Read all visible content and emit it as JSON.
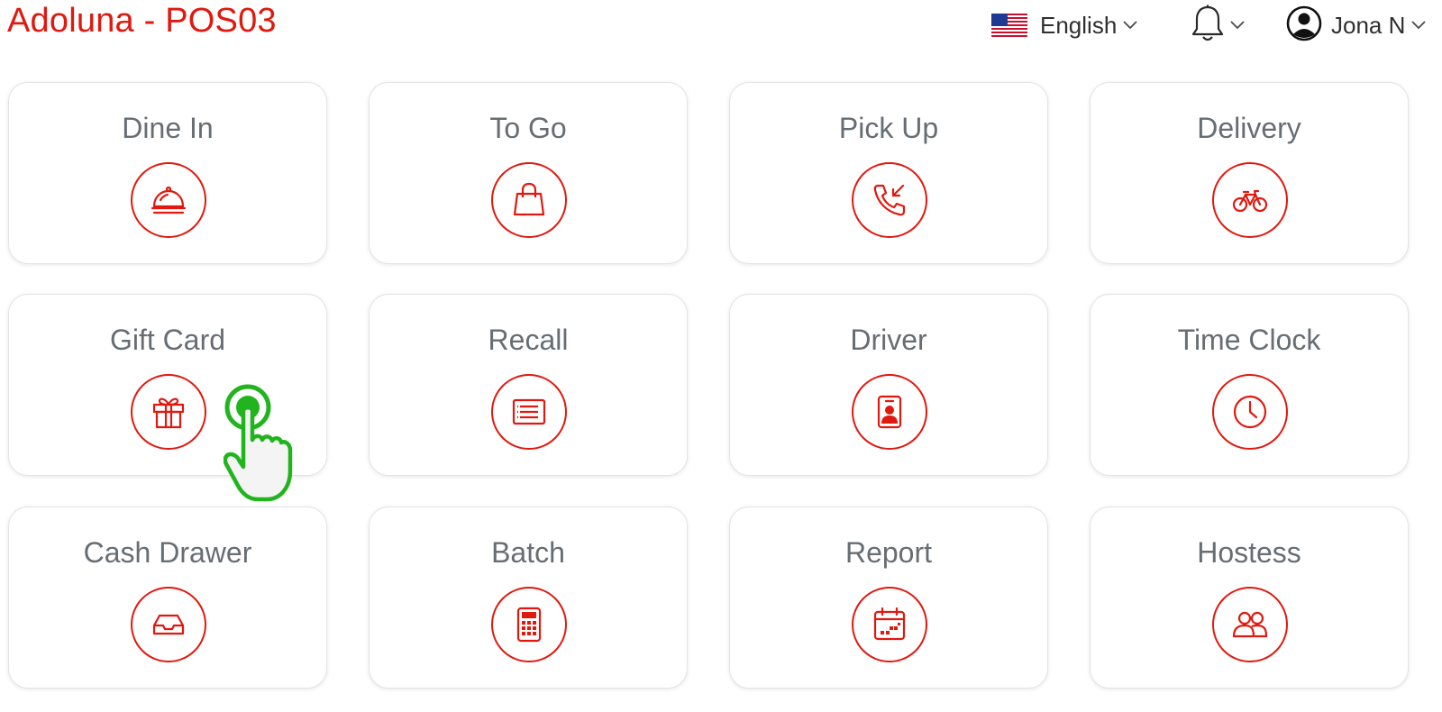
{
  "app": {
    "title": "Adoluna - POS03"
  },
  "header": {
    "language": {
      "label": "English",
      "flag_icon": "us-flag-icon"
    },
    "notifications": {
      "icon": "bell-icon"
    },
    "user": {
      "name": "Jona N",
      "icon": "user-circle-icon"
    }
  },
  "theme": {
    "accent": "#e0190f",
    "label_color": "#666d73",
    "cursor_color": "#22b41f"
  },
  "tiles": [
    {
      "label": "Dine In",
      "icon": "cloche-icon"
    },
    {
      "label": "To Go",
      "icon": "shopping-bag-icon"
    },
    {
      "label": "Pick Up",
      "icon": "phone-incoming-icon"
    },
    {
      "label": "Delivery",
      "icon": "bicycle-icon"
    },
    {
      "label": "Gift Card",
      "icon": "gift-icon"
    },
    {
      "label": "Recall",
      "icon": "receipt-list-icon"
    },
    {
      "label": "Driver",
      "icon": "driver-badge-icon"
    },
    {
      "label": "Time Clock",
      "icon": "clock-icon"
    },
    {
      "label": "Cash Drawer",
      "icon": "inbox-tray-icon"
    },
    {
      "label": "Batch",
      "icon": "calculator-icon"
    },
    {
      "label": "Report",
      "icon": "calendar-report-icon"
    },
    {
      "label": "Hostess",
      "icon": "people-icon"
    }
  ]
}
